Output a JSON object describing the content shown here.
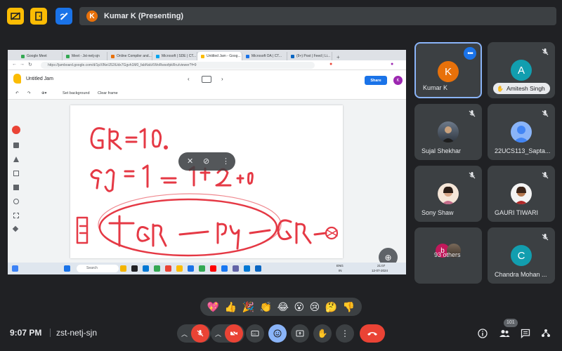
{
  "meeting": {
    "presenter_label": "Kumar K (Presenting)",
    "presenter_initial": "K",
    "time": "9:07 PM",
    "code": "zst-netj-sjn",
    "participant_count": "101"
  },
  "browser": {
    "tabs": [
      {
        "label": "Google Meet",
        "color": "#34a853"
      },
      {
        "label": "Meet - Jst-netj-sjn",
        "color": "#34a853"
      },
      {
        "label": "Online Compiler and...",
        "color": "#e8710a"
      },
      {
        "label": "Microsoft | SDE | CT...",
        "color": "#00a4ef"
      },
      {
        "label": "Untitled Jam - Goog...",
        "color": "#fbbc04"
      },
      {
        "label": "Microsoft OA | CT...",
        "color": "#1a73e8"
      },
      {
        "label": "(9+) Post | Feed | Li...",
        "color": "#0a66c2"
      }
    ],
    "url": "https://jamboard.google.com/d/1pXINeIJ52iUdx7Ggvh1M0_fabNsbXWoRwsofpkRru/viewer?f=9"
  },
  "jamboard": {
    "title": "Untitled Jam",
    "set_background": "Set background",
    "clear_frame": "Clear frame",
    "share": "Share",
    "user_initial": "K"
  },
  "taskbar": {
    "search": "Search",
    "lang": "ENG",
    "lang_region": "IN",
    "clock_time": "21:07",
    "clock_date": "12-07-2024"
  },
  "participants": [
    {
      "name": "Kumar K",
      "initial": "K",
      "color": "#e8710a"
    },
    {
      "name": "Amitesh Singh",
      "initial": "A",
      "color": "#129eaf"
    },
    {
      "name": "Sujal Shekhar"
    },
    {
      "name": "22UCS113_Sapta..."
    },
    {
      "name": "Sony Shaw"
    },
    {
      "name": "GAURI TIWARI"
    },
    {
      "name": "93 others",
      "initial": "b"
    },
    {
      "name": "Chandra Mohan ...",
      "initial": "C",
      "color": "#129eaf"
    }
  ],
  "reactions": [
    "💖",
    "👍",
    "🎉",
    "👏",
    "😂",
    "😮",
    "😢",
    "🤔",
    "👎"
  ],
  "colors": {
    "background": "#202124",
    "tile": "#3c4043",
    "accent_blue": "#8ab4f8",
    "end_call_red": "#ea4335",
    "ink_red": "#e53945"
  },
  "icons": [
    "screen-share-icon",
    "door-icon",
    "whiteboard-icon",
    "mic-off-icon",
    "camera-off-icon",
    "captions-icon",
    "emoji-icon",
    "present-icon",
    "raise-hand-icon",
    "more-options-icon",
    "end-call-icon",
    "info-icon",
    "people-icon",
    "chat-icon",
    "activities-icon"
  ]
}
